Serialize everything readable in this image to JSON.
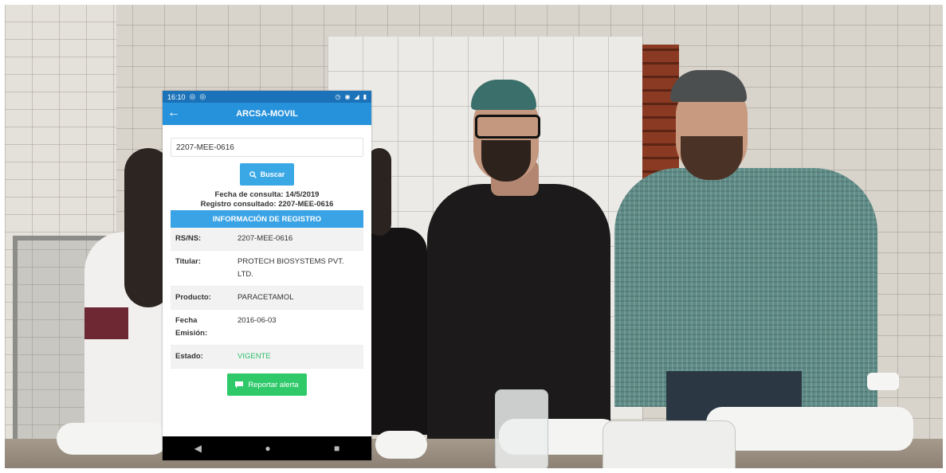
{
  "statusbar": {
    "time": "16:10"
  },
  "app": {
    "title": "ARCSA-MOVIL"
  },
  "search": {
    "value": "2207-MEE-0616",
    "button_label": "Buscar"
  },
  "meta": {
    "fecha_consulta": "Fecha de consulta: 14/5/2019",
    "registro_consultado": "Registro consultado: 2207-MEE-0616"
  },
  "info": {
    "header": "INFORMACIÓN DE REGISTRO",
    "rows": [
      {
        "label": "RS/NS:",
        "value": "2207-MEE-0616"
      },
      {
        "label": "Titular:",
        "value": "PROTECH BIOSYSTEMS PVT. LTD."
      },
      {
        "label": "Producto:",
        "value": "PARACETAMOL"
      },
      {
        "label": "Fecha Emisión:",
        "value": "2016-06-03"
      },
      {
        "label": "Estado:",
        "value": "VIGENTE"
      }
    ]
  },
  "alert": {
    "button_label": "Reportar alerta"
  },
  "colors": {
    "appbar": "#2792dc",
    "statusbar": "#1b72b8",
    "status_ok": "#2bbf69",
    "alert_button": "#2fc96a"
  },
  "icons": [
    "back-arrow-icon",
    "search-icon",
    "message-icon",
    "nav-back-icon",
    "nav-home-icon",
    "nav-recents-icon"
  ]
}
